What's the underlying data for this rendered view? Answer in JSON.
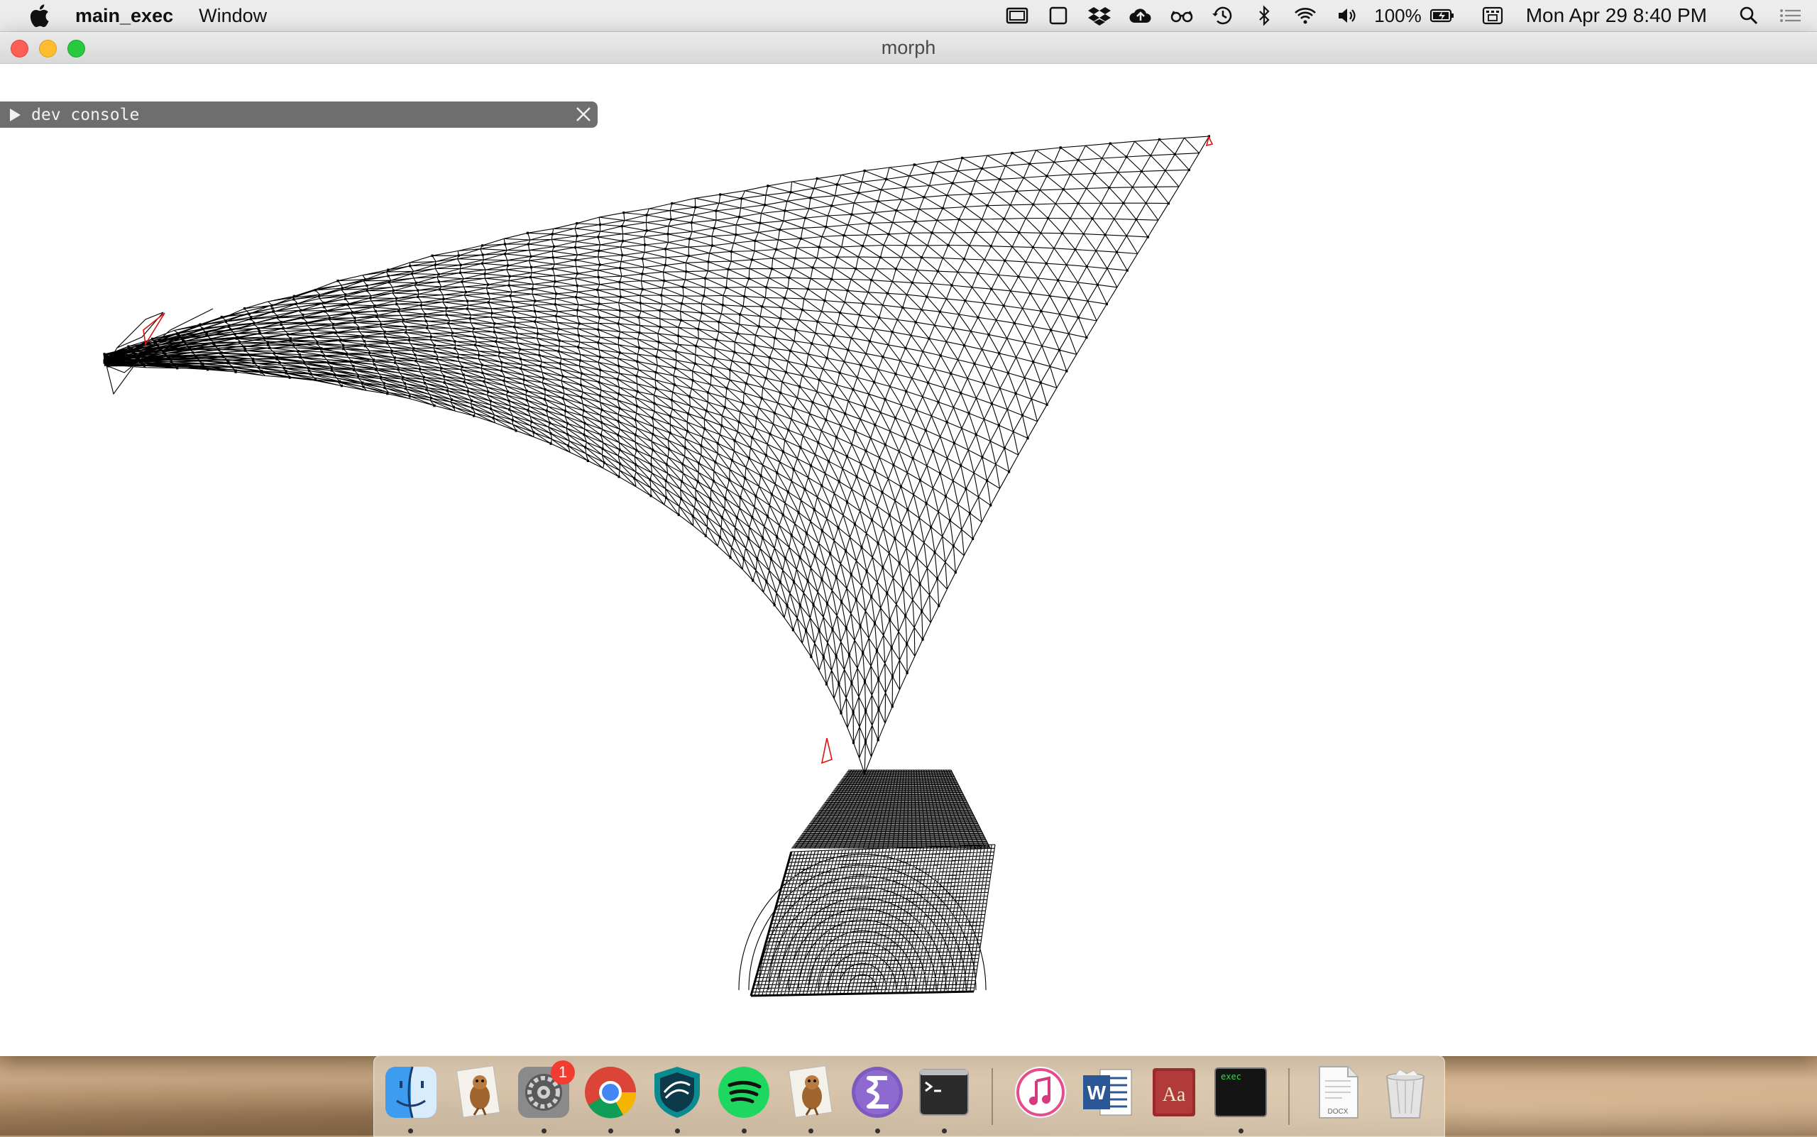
{
  "menubar": {
    "app_name": "main_exec",
    "menus": [
      "Window"
    ],
    "battery_pct": "100%",
    "clock": "Mon Apr 29  8:40 PM",
    "status_icons": [
      "display-icon",
      "window-icon",
      "dropbox-icon",
      "cloud-upload-icon",
      "glasses-icon",
      "time-machine-icon",
      "bluetooth-icon",
      "wifi-icon",
      "volume-icon",
      "battery-icon",
      "keyboard-viewer-icon",
      "spotlight-icon",
      "notification-center-icon"
    ]
  },
  "window": {
    "title": "morph"
  },
  "dev_console": {
    "label": "dev console"
  },
  "dock": {
    "items": [
      {
        "name": "finder",
        "running": true
      },
      {
        "name": "preview-beaver",
        "running": false
      },
      {
        "name": "system-preferences",
        "running": true,
        "badge": "1"
      },
      {
        "name": "chrome",
        "running": true
      },
      {
        "name": "dashlane",
        "running": true
      },
      {
        "name": "spotify",
        "running": true
      },
      {
        "name": "preview-beaver-2",
        "running": true
      },
      {
        "name": "emacs",
        "running": true
      },
      {
        "name": "terminal",
        "running": true
      },
      {
        "name": "itunes",
        "running": false
      },
      {
        "name": "word",
        "running": false
      },
      {
        "name": "dictionary",
        "running": false
      },
      {
        "name": "exec",
        "running": true
      },
      {
        "name": "docx-document",
        "running": false
      },
      {
        "name": "trash",
        "running": false
      }
    ],
    "exec_label": "exec",
    "docx_label": "DOCX"
  },
  "colors": {
    "mesh_line": "#000000",
    "mesh_highlight": "#e01010"
  }
}
